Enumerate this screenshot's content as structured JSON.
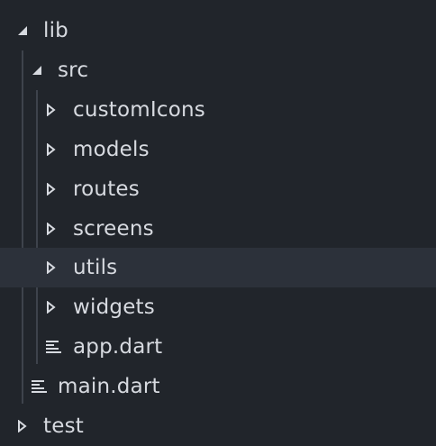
{
  "tree": {
    "root": {
      "label": "lib",
      "state": "expanded",
      "icon": "caret-down-icon"
    },
    "src": {
      "label": "src",
      "state": "expanded",
      "icon": "caret-down-icon"
    },
    "folders": [
      {
        "label": "customIcons",
        "state": "collapsed",
        "icon": "caret-right-icon"
      },
      {
        "label": "models",
        "state": "collapsed",
        "icon": "caret-right-icon"
      },
      {
        "label": "routes",
        "state": "collapsed",
        "icon": "caret-right-icon"
      },
      {
        "label": "screens",
        "state": "collapsed",
        "icon": "caret-right-icon"
      },
      {
        "label": "utils",
        "state": "collapsed",
        "icon": "caret-right-icon"
      },
      {
        "label": "widgets",
        "state": "collapsed",
        "icon": "caret-right-icon"
      }
    ],
    "src_files": [
      {
        "label": "app.dart",
        "icon": "file-text-icon"
      }
    ],
    "lib_files": [
      {
        "label": "main.dart",
        "icon": "file-text-icon"
      }
    ],
    "siblings": [
      {
        "label": "test",
        "state": "collapsed",
        "icon": "caret-right-icon"
      }
    ]
  },
  "colors": {
    "background": "#21252b",
    "hover_row": "#2c313a",
    "text": "#d7dae0",
    "icon": "#d7dae0",
    "indent_guide": "#3e434c"
  }
}
